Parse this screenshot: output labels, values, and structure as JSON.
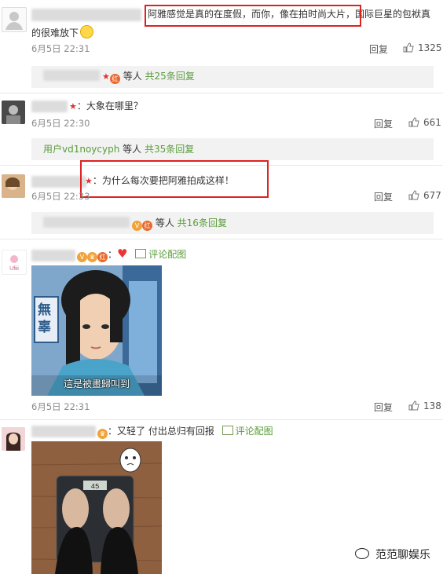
{
  "comments": [
    {
      "text_highlight": "阿雅感觉是真的在度假，而你，像在拍时尚大片",
      "text_rest": "，国际巨星的包袱真",
      "text_line2": "的很难放下",
      "time": "6月5日 22:31",
      "reply_label": "回复",
      "likes": "1325",
      "thread": {
        "suffix": "等人",
        "count": "共25条回复"
      }
    },
    {
      "text": "：大象在哪里？",
      "time": "6月5日 22:30",
      "reply_label": "回复",
      "likes": "661",
      "thread": {
        "user": "用户vd1noycyph",
        "suffix": "等人",
        "count": "共35条回复"
      }
    },
    {
      "text": "：为什么每次要把阿雅拍成这样！",
      "time": "6月5日 22:33",
      "reply_label": "回复",
      "likes": "677",
      "thread": {
        "suffix": "等人",
        "count": "共16条回复"
      }
    },
    {
      "text": "：",
      "link": "评论配图",
      "time": "6月5日 22:31",
      "reply_label": "回复",
      "likes": "138",
      "image_caption": "這是被畫歸叫到",
      "image_side_text": "無辜"
    },
    {
      "text": "：又轻了  付出总归有回报",
      "link": "评论配图",
      "scale_reading": "45"
    }
  ],
  "watermark": "范范聊娱乐",
  "colors": {
    "highlight_box": "#dd2222",
    "link_green": "#5a9c3b"
  }
}
